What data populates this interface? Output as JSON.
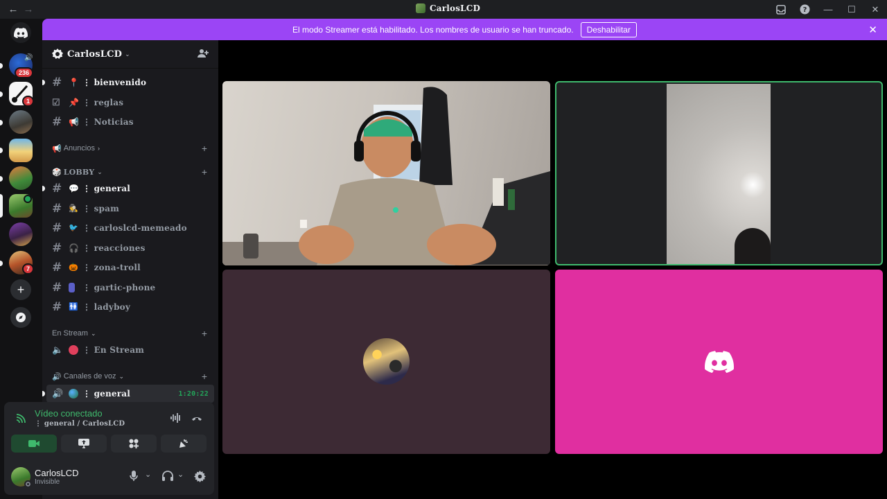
{
  "titlebar": {
    "back_icon": "arrow-left-icon",
    "forward_icon": "arrow-right-icon",
    "title": "CarlosLCD",
    "inbox_icon": "inbox-icon",
    "help_icon": "help-icon",
    "minimize_icon": "minimize-icon",
    "maximize_icon": "maximize-icon",
    "close_icon": "close-icon"
  },
  "banner": {
    "message": "El modo Streamer está habilitado. Los nombres de usuario se han truncado.",
    "button_label": "Deshabilitar",
    "close_icon": "close-icon",
    "color": "#9b45f5"
  },
  "rail": {
    "home_icon": "discord-logo-icon",
    "servers": [
      {
        "badge": "236",
        "speaker": true
      },
      {
        "badge": "1"
      },
      {
        "badge": ""
      },
      {
        "badge": ""
      },
      {
        "badge": ""
      },
      {
        "badge": "",
        "selected": true
      },
      {
        "badge": ""
      },
      {
        "badge": "7"
      }
    ],
    "add_server_icon": "plus-icon",
    "explore_icon": "compass-icon"
  },
  "sidebar": {
    "guild_name": "CarlosLCD",
    "invite_icon": "add-user-icon",
    "channels_top": [
      {
        "name": "⋮ bienvenido",
        "unread": true
      },
      {
        "name": "⋮ reglas",
        "unread": false
      },
      {
        "name": "⋮ Noticias",
        "unread": false
      }
    ],
    "categories": {
      "anuncios": "Anuncios",
      "lobby": "LOBBY",
      "en_stream": "En Stream",
      "voz": "Canales de voz"
    },
    "lobby_channels": [
      {
        "name": "⋮ general",
        "unread": true
      },
      {
        "name": "⋮ spam",
        "unread": false
      },
      {
        "name": "⋮ carloslcd-memeado",
        "unread": false
      },
      {
        "name": "⋮ reacciones",
        "unread": false
      },
      {
        "name": "⋮ zona-troll",
        "unread": false
      },
      {
        "name": "⋮ gartic-phone",
        "unread": false
      },
      {
        "name": "⋮ ladyboy",
        "unread": false
      }
    ],
    "stream_channel": "⋮ En Stream",
    "voice_channel": {
      "name": "⋮ general",
      "timer": "1:20:22"
    }
  },
  "voice_panel": {
    "status": "Vídeo conectado",
    "location": "⋮ general / CarlosLCD",
    "accent": "#3fba6d",
    "actions": [
      "camera-icon",
      "screen-share-icon",
      "activities-icon",
      "soundboard-icon"
    ]
  },
  "user": {
    "name": "CarlosLCD",
    "status": "Invisible"
  },
  "stage": {
    "tile_colors": {
      "avatar_tile": "#3d2a34",
      "logo_tile": "#e02fa0",
      "speaking_border": "#3fba6d"
    }
  }
}
